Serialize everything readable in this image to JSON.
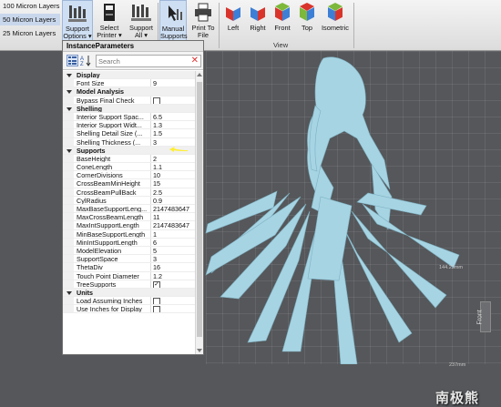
{
  "ribbon": {
    "layers": [
      "100 Micron Layers",
      "50 Micron Layers",
      "25 Micron Layers"
    ],
    "support_options_label": "Support",
    "support_options_sub": "Options ▾",
    "select_printer_label": "Select",
    "select_printer_sub": "Printer ▾",
    "support_all_label": "Support",
    "support_all_sub": "All ▾",
    "manual_supports_label": "Manual",
    "manual_supports_sub": "Supports",
    "print_to_file_label": "Print To",
    "print_to_file_sub": "File",
    "views": [
      "Left",
      "Right",
      "Front",
      "Top",
      "Isometric"
    ],
    "view_group_label": "View"
  },
  "panel": {
    "title": "InstanceParameters",
    "search_placeholder": "Search",
    "sections": [
      {
        "category": "Display",
        "rows": [
          {
            "name": "Font Size",
            "value": "9"
          }
        ]
      },
      {
        "category": "Model Analysis",
        "rows": [
          {
            "name": "Bypass Final Check",
            "value": "",
            "checkbox": true,
            "checked": false
          }
        ]
      },
      {
        "category": "Shelling",
        "rows": [
          {
            "name": "Interior Support Spac...",
            "value": "6.5"
          },
          {
            "name": "Interior Support Widt...",
            "value": "1.3"
          },
          {
            "name": "Shelling Detail Size (...",
            "value": "1.5"
          },
          {
            "name": "Shelling Thickness (...",
            "value": "3"
          }
        ]
      },
      {
        "category": "Supports",
        "rows": [
          {
            "name": "BaseHeight",
            "value": "2"
          },
          {
            "name": "ConeLength",
            "value": "1.1"
          },
          {
            "name": "CornerDivisions",
            "value": "10"
          },
          {
            "name": "CrossBeamMinHeight",
            "value": "15"
          },
          {
            "name": "CrossBeamPullBack",
            "value": "2.5"
          },
          {
            "name": "CylRadius",
            "value": "0.9"
          },
          {
            "name": "MaxBaseSupportLeng...",
            "value": "2147483647"
          },
          {
            "name": "MaxCrossBeamLength",
            "value": "11"
          },
          {
            "name": "MaxIntSupportLength",
            "value": "2147483647"
          },
          {
            "name": "MinBaseSupportLength",
            "value": "1"
          },
          {
            "name": "MinIntSupportLength",
            "value": "6"
          },
          {
            "name": "ModelElevation",
            "value": "5"
          },
          {
            "name": "SupportSpace",
            "value": "3"
          },
          {
            "name": "ThetaDiv",
            "value": "16"
          },
          {
            "name": "Touch Point Diameter",
            "value": "1.2"
          },
          {
            "name": "TreeSupports",
            "value": "",
            "checkbox": true,
            "checked": true
          }
        ]
      },
      {
        "category": "Units",
        "rows": [
          {
            "name": "Load Assuming Inches",
            "value": "",
            "checkbox": true,
            "checked": false
          },
          {
            "name": "Use Inches for Display",
            "value": "",
            "checkbox": true,
            "checked": false
          }
        ]
      }
    ]
  },
  "viewport": {
    "dimension_1": "144.23mm",
    "dimension_2": "237mm",
    "front_tab": "Front",
    "model_color": "#a6d4e3"
  },
  "watermark": "南极熊"
}
